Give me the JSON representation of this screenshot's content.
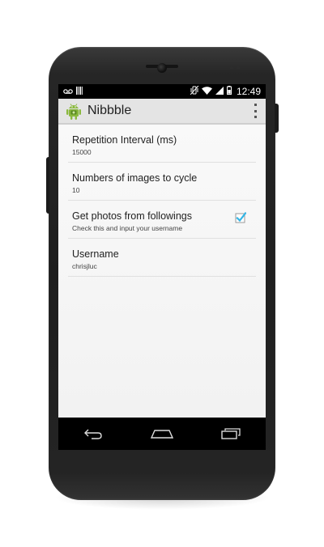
{
  "status_bar": {
    "time": "12:49",
    "left_icons": [
      "voicemail-icon",
      "barcode-icon"
    ],
    "right_icons": [
      "vibrate-icon",
      "wifi-icon",
      "signal-icon",
      "battery-icon"
    ]
  },
  "action_bar": {
    "title": "Nibbble",
    "app_icon": "android-robot-icon",
    "overflow_icon": "overflow-menu-icon"
  },
  "preferences": [
    {
      "title": "Repetition Interval (ms)",
      "summary": "15000"
    },
    {
      "title": "Numbers of images to cycle",
      "summary": "10"
    },
    {
      "title": "Get photos from followings",
      "summary": "Check this and input your username",
      "checked": true
    },
    {
      "title": "Username",
      "summary": "chrisjluc"
    }
  ],
  "navigation_bar": {
    "buttons": [
      "back-icon",
      "home-icon",
      "recent-apps-icon"
    ]
  },
  "colors": {
    "accent": "#33b5e5",
    "status_bar": "#000000",
    "action_bar": "#e4e4e4",
    "android_green": "#8ab83e"
  }
}
